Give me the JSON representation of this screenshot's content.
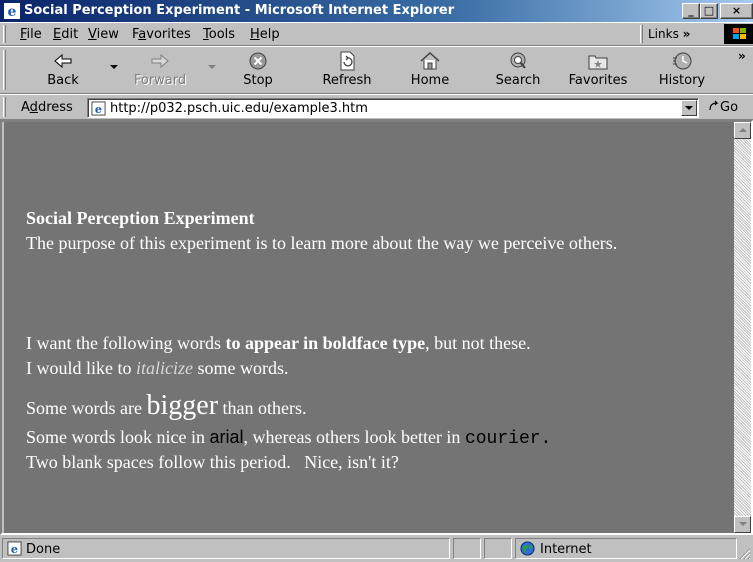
{
  "window": {
    "title": "Social Perception Experiment - Microsoft Internet Explorer",
    "controls": [
      "_",
      "□",
      "×"
    ]
  },
  "menu": {
    "items": [
      {
        "label": "File",
        "ul": "F",
        "rest": "ile"
      },
      {
        "label": "Edit",
        "ul": "E",
        "rest": "dit"
      },
      {
        "label": "View",
        "ul": "V",
        "rest": "iew"
      },
      {
        "label": "Favorites",
        "pre": "F",
        "ul": "a",
        "rest": "vorites"
      },
      {
        "label": "Tools",
        "ul": "T",
        "rest": "ools"
      },
      {
        "label": "Help",
        "ul": "H",
        "rest": "elp"
      }
    ],
    "links_label": "Links",
    "links_chevron": "»"
  },
  "toolbar": {
    "back": "Back",
    "forward": "Forward",
    "stop": "Stop",
    "refresh": "Refresh",
    "home": "Home",
    "search": "Search",
    "favorites": "Favorites",
    "history": "History",
    "more": "»"
  },
  "address": {
    "label_ul": "d",
    "label_pre": "A",
    "label_rest": "dress",
    "url": "http://p032.psch.uic.edu/example3.htm",
    "go": "Go"
  },
  "page": {
    "heading": "Social Perception Experiment",
    "intro": "The purpose of this experiment is to learn more about the way we perceive others.",
    "bold_line": {
      "before": "I want the following words ",
      "bold": "to appear in boldface type",
      "after": ", but not these."
    },
    "italic_line": {
      "before": "I would like to ",
      "italic": "italicize",
      "after": " some words."
    },
    "big_line": {
      "before": "Some words are ",
      "big": "bigger",
      "after": " than others."
    },
    "font_line": {
      "before": "Some words look nice in ",
      "arial": "arial",
      "middle": ", whereas others look better in ",
      "courier": "courier."
    },
    "spaces_line": "Two blank spaces follow this period.   Nice, isn't it?"
  },
  "status": {
    "text": "Done",
    "zone": "Internet"
  },
  "colors": {
    "page_background": "#747474",
    "page_text": "#ffffff",
    "titlebar_start": "#0a246a",
    "titlebar_end": "#a6caf0"
  }
}
